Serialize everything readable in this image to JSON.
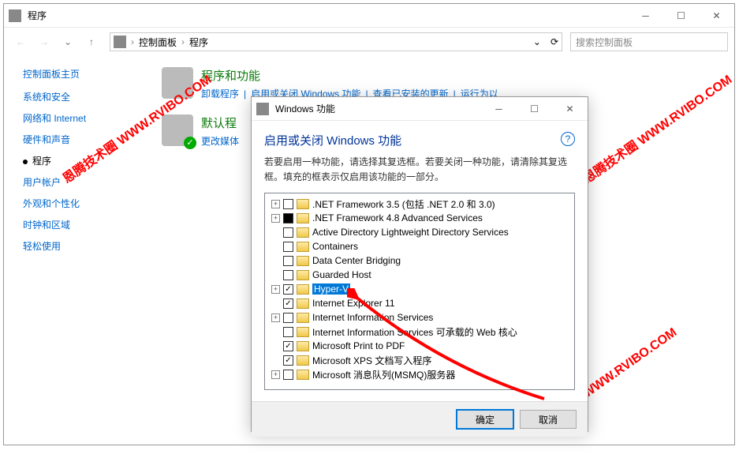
{
  "mainWindow": {
    "title": "程序",
    "breadcrumb": [
      "控制面板",
      "程序"
    ],
    "searchPlaceholder": "搜索控制面板"
  },
  "sidebar": {
    "head": "控制面板主页",
    "items": [
      {
        "label": "系统和安全"
      },
      {
        "label": "网络和 Internet"
      },
      {
        "label": "硬件和声音"
      },
      {
        "label": "程序",
        "active": true
      },
      {
        "label": "用户帐户"
      },
      {
        "label": "外观和个性化"
      },
      {
        "label": "时钟和区域"
      },
      {
        "label": "轻松使用"
      }
    ]
  },
  "sections": [
    {
      "title": "程序和功能",
      "links": [
        "卸载程序",
        "启用或关闭 Windows 功能",
        "查看已安装的更新",
        "运行为以"
      ]
    },
    {
      "title": "默认程",
      "links": [
        "更改媒体"
      ]
    }
  ],
  "dialog": {
    "title": "Windows 功能",
    "heading": "启用或关闭 Windows 功能",
    "desc": "若要启用一种功能，请选择其复选框。若要关闭一种功能，请清除其复选框。填充的框表示仅启用该功能的一部分。",
    "ok": "确定",
    "cancel": "取消",
    "features": [
      {
        "exp": "+",
        "cb": "",
        "label": ".NET Framework 3.5 (包括 .NET 2.0 和 3.0)"
      },
      {
        "exp": "+",
        "cb": "filled",
        "label": ".NET Framework 4.8 Advanced Services"
      },
      {
        "exp": "",
        "cb": "",
        "label": "Active Directory Lightweight Directory Services"
      },
      {
        "exp": "",
        "cb": "",
        "label": "Containers"
      },
      {
        "exp": "",
        "cb": "",
        "label": "Data Center Bridging"
      },
      {
        "exp": "",
        "cb": "",
        "label": "Guarded Host"
      },
      {
        "exp": "+",
        "cb": "checked",
        "label": "Hyper-V",
        "selected": true
      },
      {
        "exp": "",
        "cb": "checked",
        "label": "Internet Explorer 11"
      },
      {
        "exp": "+",
        "cb": "",
        "label": "Internet Information Services"
      },
      {
        "exp": "",
        "cb": "",
        "label": "Internet Information Services 可承载的 Web 核心"
      },
      {
        "exp": "",
        "cb": "checked",
        "label": "Microsoft Print to PDF"
      },
      {
        "exp": "",
        "cb": "checked",
        "label": "Microsoft XPS 文档写入程序"
      },
      {
        "exp": "+",
        "cb": "",
        "label": "Microsoft 消息队列(MSMQ)服务器"
      }
    ]
  },
  "watermark": "恩腾技术圈 WWW.RVIBO.COM"
}
